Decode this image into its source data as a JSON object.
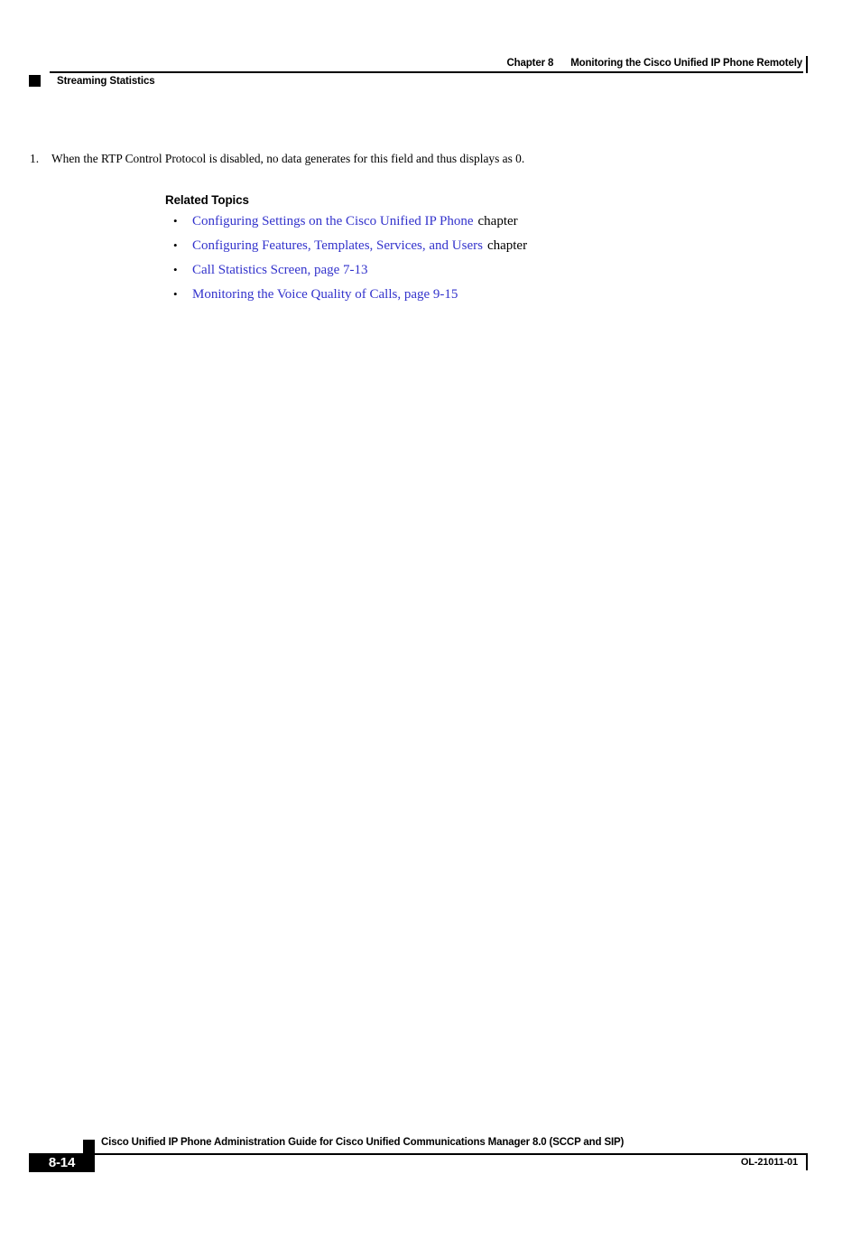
{
  "header": {
    "chapter_label": "Chapter 8",
    "chapter_title": "Monitoring the Cisco Unified IP Phone Remotely",
    "running_head": "Streaming Statistics"
  },
  "body": {
    "footnote": {
      "number": "1.",
      "text": "When the RTP Control Protocol is disabled, no data generates for this field and thus displays as 0."
    },
    "related_topics": {
      "heading": "Related Topics",
      "bullet_glyph": "•",
      "link_color": "#3333CC",
      "items": [
        {
          "link": "Configuring Settings on the Cisco Unified IP Phone",
          "trailing": "chapter"
        },
        {
          "link": "Configuring Features, Templates, Services, and Users",
          "trailing": "chapter"
        },
        {
          "link": "Call Statistics Screen, page 7-13",
          "trailing": ""
        },
        {
          "link": "Monitoring the Voice Quality of Calls, page 9-15",
          "trailing": ""
        }
      ]
    }
  },
  "footer": {
    "guide_title": "Cisco Unified IP Phone Administration Guide for Cisco Unified Communications Manager 8.0 (SCCP and SIP)",
    "page_number": "8-14",
    "document_id": "OL-21011-01"
  }
}
